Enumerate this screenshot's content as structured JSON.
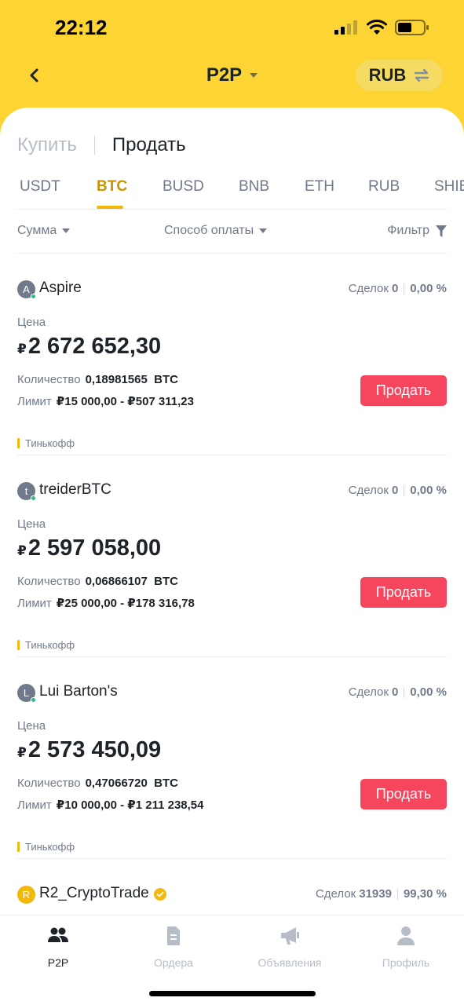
{
  "status_bar": {
    "time": "22:12"
  },
  "header": {
    "title": "P2P",
    "currency": "RUB"
  },
  "side_tabs": {
    "buy": "Купить",
    "sell": "Продать"
  },
  "coin_tabs": [
    "USDT",
    "BTC",
    "BUSD",
    "BNB",
    "ETH",
    "RUB",
    "SHIB"
  ],
  "active_coin": "BTC",
  "filters": {
    "amount": "Сумма",
    "payment": "Способ оплаты",
    "filter": "Фильтр"
  },
  "offers": [
    {
      "avatar": "A",
      "name": "Aspire",
      "deals_label": "Сделок",
      "deals": "0",
      "completion": "0,00 %",
      "price_label": "Цена",
      "currency_sign": "₽",
      "price": "2 672 652,30",
      "qty_label": "Количество",
      "qty": "0,18981565  BTC",
      "limit_label": "Лимит",
      "limit": "₽15 000,00 - ₽507 311,23",
      "button": "Продать",
      "payment": "Тинькофф"
    },
    {
      "avatar": "t",
      "name": "treiderBTC",
      "deals_label": "Сделок",
      "deals": "0",
      "completion": "0,00 %",
      "price_label": "Цена",
      "currency_sign": "₽",
      "price": "2 597 058,00",
      "qty_label": "Количество",
      "qty": "0,06866107  BTC",
      "limit_label": "Лимит",
      "limit": "₽25 000,00 - ₽178 316,78",
      "button": "Продать",
      "payment": "Тинькофф"
    },
    {
      "avatar": "L",
      "name": "Lui Barton's",
      "deals_label": "Сделок",
      "deals": "0",
      "completion": "0,00 %",
      "price_label": "Цена",
      "currency_sign": "₽",
      "price": "2 573 450,09",
      "qty_label": "Количество",
      "qty": "0,47066720  BTC",
      "limit_label": "Лимит",
      "limit": "₽10 000,00 - ₽1 211 238,54",
      "button": "Продать",
      "payment": "Тинькофф"
    }
  ],
  "partial_offer": {
    "avatar": "R",
    "name": "R2_CryptoTrade",
    "deals_label": "Сделок",
    "deals": "31939",
    "completion": "99,30 %"
  },
  "bottom_nav": [
    {
      "label": "P2P",
      "icon": "users-icon",
      "active": true
    },
    {
      "label": "Ордера",
      "icon": "document-icon",
      "active": false
    },
    {
      "label": "Объявления",
      "icon": "megaphone-icon",
      "active": false
    },
    {
      "label": "Профиль",
      "icon": "person-icon",
      "active": false
    }
  ],
  "colors": {
    "brand_yellow": "#FCD535",
    "accent": "#F0B90B",
    "sell_red": "#F6465D",
    "online_green": "#2EBD85"
  }
}
